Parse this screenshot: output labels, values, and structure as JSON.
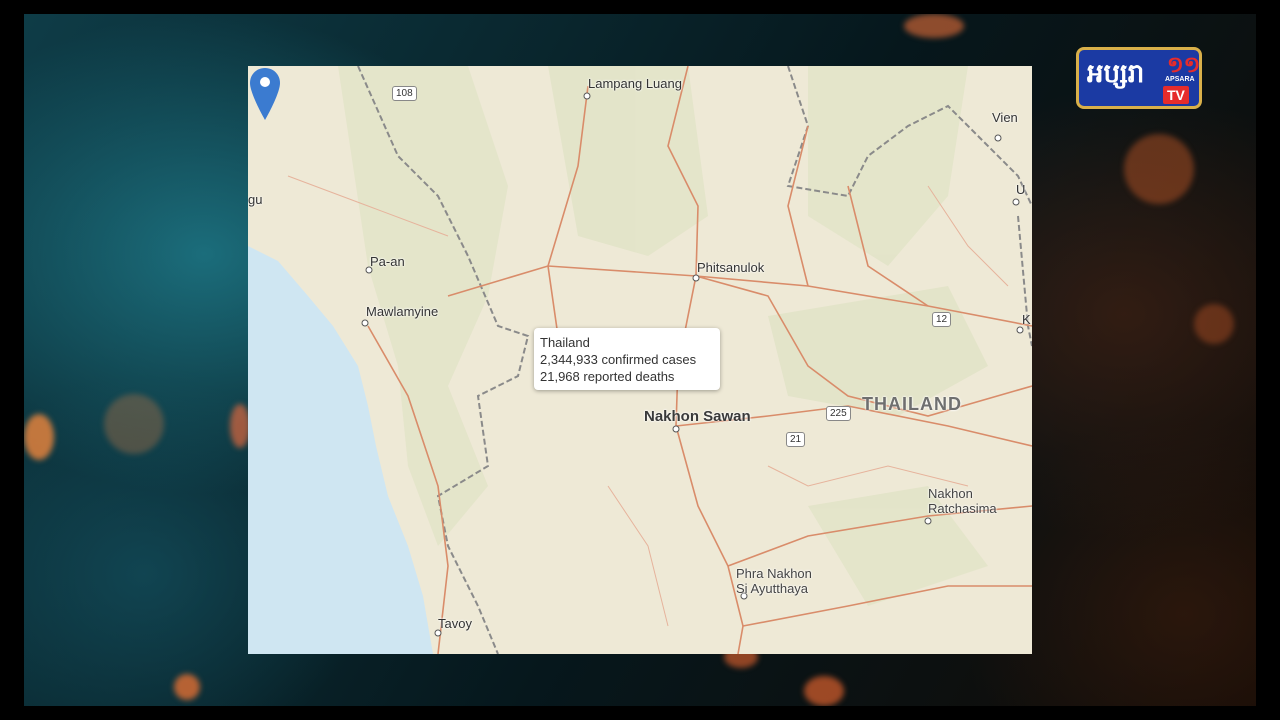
{
  "map": {
    "popup": {
      "country": "Thailand",
      "confirmed": "2,344,933 confirmed cases",
      "deaths": "21,968 reported deaths"
    },
    "labels": {
      "lampang_luang": "Lampang Luang",
      "vientiane_partial": "Vien",
      "u_partial": "U",
      "k_partial": "K",
      "gu_partial": "gu",
      "pa_an": "Pa-an",
      "mawlamyine": "Mawlamyine",
      "phitsanulok": "Phitsanulok",
      "nakhon_sawan": "Nakhon Sawan",
      "thailand": "THAILAND",
      "nakhon_ratchasima": "Nakhon\nRatchasima",
      "phra_nakhon": "Phra Nakhon\nSi Ayutthaya",
      "tavoy": "Tavoy"
    },
    "shields": {
      "r108": "108",
      "r12": "12",
      "r225": "225",
      "r21": "21"
    }
  },
  "logo": {
    "text": "អប្សរា",
    "number": "១១",
    "small": "APSARA",
    "tv": "TV"
  },
  "colors": {
    "land": "#eee9d6",
    "water": "#cfe6f2",
    "road": "#d98c6a",
    "border": "#8a8a8a",
    "marker": "#3b7bd0"
  }
}
